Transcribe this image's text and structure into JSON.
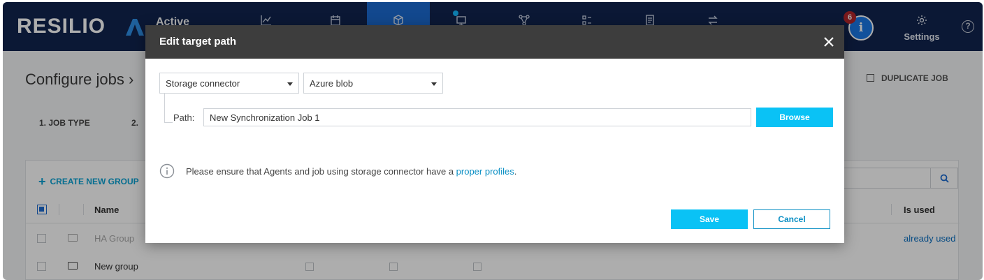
{
  "app": {
    "logo_text": "RESILIO",
    "product_text": "Active",
    "accent_color": "#0ac2f5",
    "nav_bg_color": "#11244e",
    "active_tab_color": "#1b6bd1"
  },
  "nav": {
    "tabs": [
      {
        "icon": "dashboard-chart-icon"
      },
      {
        "icon": "schedule-icon"
      },
      {
        "icon": "jobs-icon",
        "active": true
      },
      {
        "icon": "agents-icon"
      },
      {
        "icon": "groups-icon"
      },
      {
        "icon": "storage-icon"
      },
      {
        "icon": "reports-icon"
      },
      {
        "icon": "transfers-icon"
      }
    ],
    "notification_count": "6",
    "info_glyph": "i",
    "settings_label": "Settings",
    "help_glyph": "?"
  },
  "page": {
    "title": "Configure jobs ›",
    "duplicate_label": "DUPLICATE JOB",
    "steps": [
      "1. JOB TYPE",
      "2."
    ],
    "create_group_label": "CREATE NEW GROUP",
    "table": {
      "headers": {
        "name": "Name",
        "is_used": "Is used"
      },
      "rows": [
        {
          "name": "HA Group",
          "status": "already used",
          "muted": true
        },
        {
          "name": "New group",
          "status": "",
          "muted": false
        }
      ]
    }
  },
  "modal": {
    "title": "Edit target path",
    "type_select": {
      "value": "Storage connector"
    },
    "storage_select": {
      "value": "Azure blob"
    },
    "path_label": "Path:",
    "path_value": "New Synchronization Job 1",
    "browse_label": "Browse",
    "info_text_before": "Please ensure that Agents and job using storage connector have a ",
    "info_link": "proper profiles",
    "info_text_after": ".",
    "save_label": "Save",
    "cancel_label": "Cancel"
  }
}
